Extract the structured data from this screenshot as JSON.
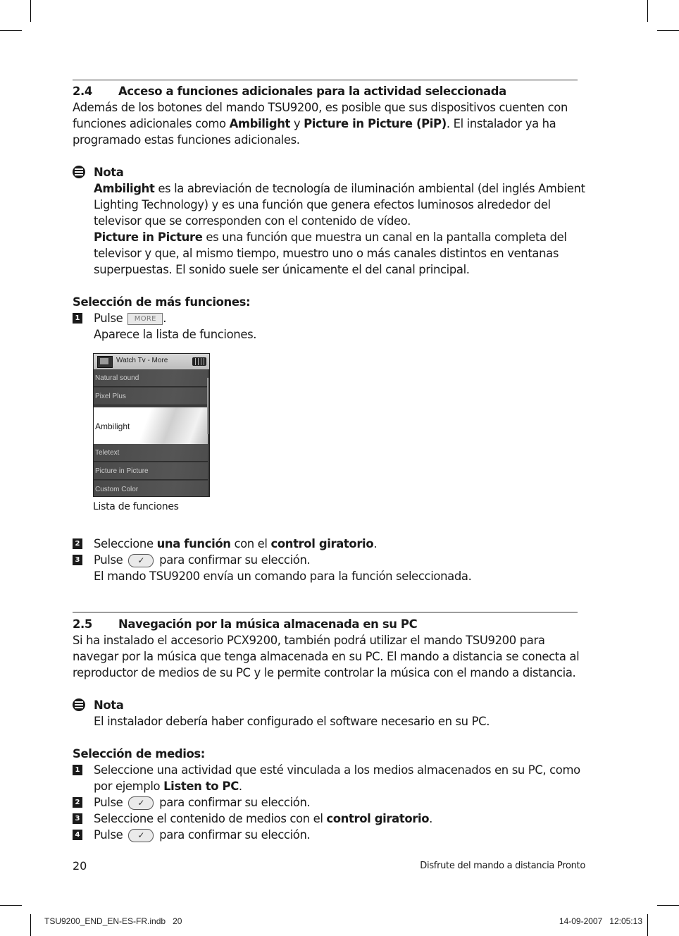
{
  "section_24": {
    "number": "2.4",
    "title": "Acceso a funciones adicionales para la actividad seleccionada",
    "intro_l1": "Además de los botones del mando TSU9200, es posible que sus dispositivos cuenten con",
    "intro_l2_a": "funciones adicionales como ",
    "intro_l2_b": "Ambilight",
    "intro_l2_c": " y ",
    "intro_l2_d": "Picture in Picture (PiP)",
    "intro_l2_e": ". El instalador ya ha",
    "intro_l3": "programado estas funciones adicionales.",
    "note": {
      "icon": "note-icon",
      "label": "Nota",
      "l1_a": "Ambilight",
      "l1_b": " es la abreviación de tecnología de iluminación ambiental (del inglés Ambient",
      "l2": "Lighting Technology) y es una función que genera efectos luminosos alrededor del",
      "l3": "televisor que se corresponden con el contenido de vídeo.",
      "l4_a": "Picture in Picture",
      "l4_b": " es una función que muestra un canal en la pantalla completa del",
      "l5": "televisor y que, al mismo tiempo, muestro uno o más canales distintos en ventanas",
      "l6": "superpuestas. El sonido suele ser únicamente el del canal principal."
    },
    "subhead": "Selección de más funciones:",
    "steps": [
      {
        "n": "1",
        "a": "Pulse ",
        "button": "MORE",
        "b": ".",
        "sub": "Aparece la lista de funciones."
      },
      {
        "n": "2",
        "a": "Seleccione ",
        "b1": "una función",
        "c": " con el ",
        "b2": "control giratorio",
        "d": "."
      },
      {
        "n": "3",
        "a": "Pulse ",
        "button_icon": "check-icon",
        "b": " para confirmar su elección.",
        "sub": "El mando TSU9200 envía un comando para la función seleccionada."
      }
    ],
    "screen": {
      "title": "Watch Tv - More",
      "items": [
        "Natural sound",
        "Pixel Plus",
        "Ambilight",
        "Teletext",
        "Picture in Picture",
        "Custom Color"
      ],
      "selected": "Ambilight",
      "caption": "Lista de funciones"
    }
  },
  "section_25": {
    "number": "2.5",
    "title": "Navegación por la música almacenada en su PC",
    "intro_l1": "Si ha instalado el accesorio PCX9200, también podrá utilizar el mando TSU9200 para",
    "intro_l2": "navegar por la música que tenga almacenada en su PC. El mando a distancia se conecta al",
    "intro_l3": "reproductor de medios de su PC y le permite controlar la música con el mando a distancia.",
    "note": {
      "label": "Nota",
      "text": "El instalador debería haber configurado el software necesario en su PC."
    },
    "subhead": "Selección de medios:",
    "steps": [
      {
        "n": "1",
        "a": "Seleccione una actividad que esté vinculada a los medios almacenados en su PC, como",
        "a2": "por ejemplo ",
        "b": "Listen to PC",
        "c": "."
      },
      {
        "n": "2",
        "a": "Pulse ",
        "b": " para confirmar su elección."
      },
      {
        "n": "3",
        "a": "Seleccione el contenido de medios con el ",
        "b": "control giratorio",
        "c": "."
      },
      {
        "n": "4",
        "a": "Pulse ",
        "b": " para confirmar su elección."
      }
    ]
  },
  "footer": {
    "page_number": "20",
    "running_title": "Disfrute del mando a distancia Pronto",
    "slug_file": "TSU9200_END_EN-ES-FR.indb   20",
    "slug_date": "14-09-2007   12:05:13"
  },
  "glyphs": {
    "check": "✓"
  }
}
